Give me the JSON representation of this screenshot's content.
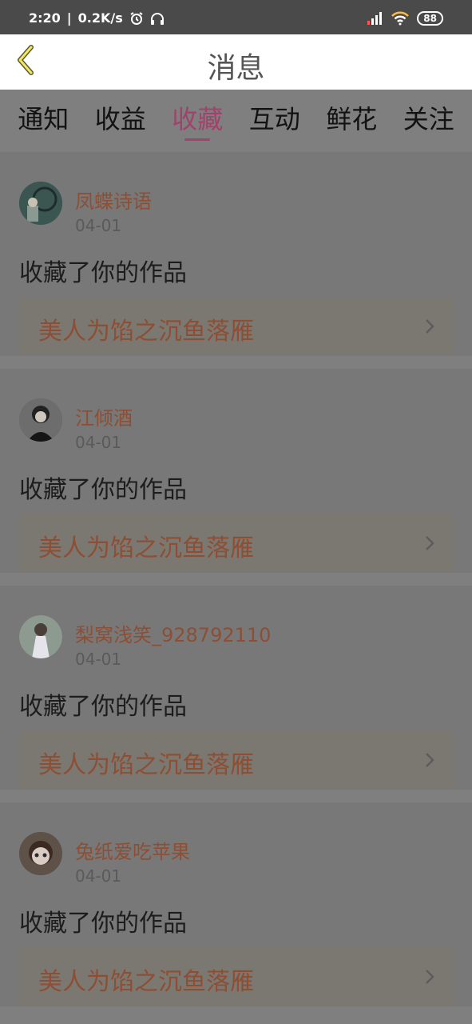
{
  "status_bar": {
    "time": "2:20",
    "speed": "0.2K/s",
    "battery": "88",
    "icons": [
      "alarm-icon",
      "headphones-icon",
      "signal-icon",
      "wifi-icon",
      "battery-icon"
    ]
  },
  "header": {
    "title": "消息",
    "back_icon": "chevron-left-icon"
  },
  "tabs": [
    {
      "label": "通知"
    },
    {
      "label": "收益"
    },
    {
      "label": "收藏",
      "active": true
    },
    {
      "label": "互动"
    },
    {
      "label": "鲜花"
    },
    {
      "label": "关注"
    }
  ],
  "messages": [
    {
      "username": "凤蝶诗语",
      "date": "04-01",
      "action": "收藏了你的作品",
      "work_title": "美人为馅之沉鱼落雁"
    },
    {
      "username": "江倾酒",
      "date": "04-01",
      "action": "收藏了你的作品",
      "work_title": "美人为馅之沉鱼落雁"
    },
    {
      "username": "梨窝浅笑_928792110",
      "date": "04-01",
      "action": "收藏了你的作品",
      "work_title": "美人为馅之沉鱼落雁"
    },
    {
      "username": "兔纸爱吃苹果",
      "date": "04-01",
      "action": "收藏了你的作品",
      "work_title": "美人为馅之沉鱼落雁"
    }
  ],
  "colors": {
    "accent": "#a0426a",
    "username": "#8e4e34",
    "overlay": "#7f7f7f"
  }
}
